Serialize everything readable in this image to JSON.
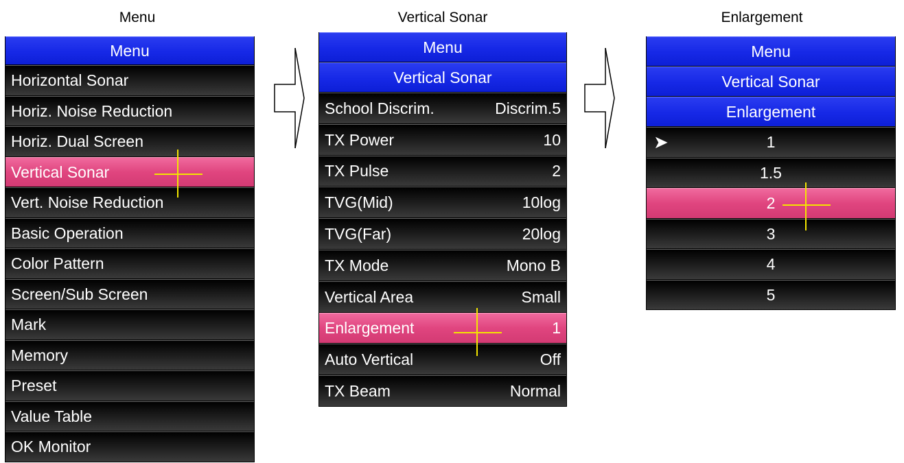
{
  "captions": {
    "menu": "Menu",
    "vertical_sonar": "Vertical Sonar",
    "enlargement": "Enlargement"
  },
  "panel1": {
    "header": "Menu",
    "items": [
      "Horizontal Sonar",
      "Horiz. Noise Reduction",
      "Horiz. Dual Screen",
      "Vertical Sonar",
      "Vert. Noise Reduction",
      "Basic Operation",
      "Color Pattern",
      "Screen/Sub Screen",
      "Mark",
      "Memory",
      "Preset",
      "Value Table",
      "OK Monitor"
    ],
    "selected": "Vertical Sonar"
  },
  "panel2": {
    "headers": [
      "Menu",
      "Vertical Sonar"
    ],
    "items": [
      {
        "label": "School Discrim.",
        "value": "Discrim.5"
      },
      {
        "label": "TX Power",
        "value": "10"
      },
      {
        "label": "TX Pulse",
        "value": "2"
      },
      {
        "label": "TVG(Mid)",
        "value": "10log"
      },
      {
        "label": "TVG(Far)",
        "value": "20log"
      },
      {
        "label": "TX Mode",
        "value": "Mono B"
      },
      {
        "label": "Vertical Area",
        "value": "Small"
      },
      {
        "label": "Enlargement",
        "value": "1"
      },
      {
        "label": "Auto Vertical",
        "value": "Off"
      },
      {
        "label": "TX Beam",
        "value": "Normal"
      }
    ],
    "selected": "Enlargement"
  },
  "panel3": {
    "headers": [
      "Menu",
      "Vertical Sonar",
      "Enlargement"
    ],
    "options": [
      "1",
      "1.5",
      "2",
      "3",
      "4",
      "5"
    ],
    "current": "1",
    "selected": "2"
  },
  "icons": {
    "current_marker": "arrow-pointer-icon",
    "cursor": "crosshair-cursor-icon",
    "flow_arrow": "right-arrow-icon"
  },
  "colors": {
    "header": "#1628e6",
    "row": "#1a1a1a",
    "selected": "#e0457f",
    "cursor": "#f3e600",
    "text": "#ffffff"
  }
}
